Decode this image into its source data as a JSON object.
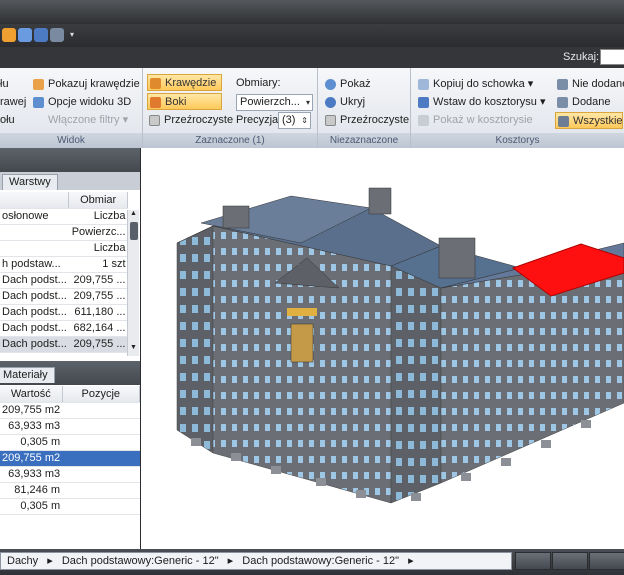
{
  "search": {
    "label": "Szukaj:"
  },
  "ribbon": {
    "group_view": {
      "label": "Widok",
      "items": [
        "łu",
        "rawej",
        "ołu"
      ],
      "show_edges": "Pokazuj krawędzie",
      "view3d_options": "Opcje widoku 3D",
      "filters": "Włączone filtry"
    },
    "group_selected": {
      "label": "Zaznaczone (1)",
      "edges": "Krawędzie",
      "sides": "Boki",
      "transparent": "Przeźroczyste",
      "measures_label": "Obmiary:",
      "measures_value": "Powierzch...",
      "precision_label": "Precyzja",
      "precision_value": "(3)"
    },
    "group_unselected": {
      "label": "Niezaznaczone",
      "show": "Pokaż",
      "hide": "Ukryj",
      "transparent": "Przeźroczyste"
    },
    "group_estimate": {
      "label": "Kosztorys",
      "copy": "Kopiuj do schowka",
      "insert": "Wstaw do kosztorysu",
      "show_in": "Pokaż w kosztorysie",
      "not_added": "Nie dodane",
      "added": "Dodane",
      "all": "Wszystkie"
    }
  },
  "layers_panel": {
    "tab": "Warstwy",
    "col_measure": "Obmiar",
    "rows": [
      {
        "name": "osłonowe",
        "value": "Liczba"
      },
      {
        "name": "",
        "value": "Powierzc..."
      },
      {
        "name": "",
        "value": "Liczba"
      },
      {
        "name": "h podstaw...",
        "value": "1 szt"
      },
      {
        "name": "Dach podst...",
        "value": "209,755 ..."
      },
      {
        "name": "Dach podst...",
        "value": "209,755 ..."
      },
      {
        "name": "Dach podst...",
        "value": "611,180 ..."
      },
      {
        "name": "Dach podst...",
        "value": "682,164 ..."
      },
      {
        "name": "Dach podst...",
        "value": "209,755 ..."
      }
    ]
  },
  "materials_panel": {
    "tab": "Materiały",
    "col_value": "Wartość",
    "col_positions": "Pozycje",
    "rows": [
      {
        "value": "209,755 m2",
        "pos": ""
      },
      {
        "value": "63,933 m3",
        "pos": ""
      },
      {
        "value": "0,305 m",
        "pos": ""
      },
      {
        "value": "209,755 m2",
        "pos": ""
      },
      {
        "value": "63,933 m3",
        "pos": ""
      },
      {
        "value": "81,246 m",
        "pos": ""
      },
      {
        "value": "0,305 m",
        "pos": ""
      }
    ]
  },
  "breadcrumb": [
    "Dachy",
    "Dach podstawowy:Generic - 12\"",
    "Dach podstawowy:Generic - 12\""
  ],
  "colors": {
    "accent": "#3a6fc0",
    "selection": "#ff1010",
    "ribbon_selected": "#ffc95a"
  }
}
